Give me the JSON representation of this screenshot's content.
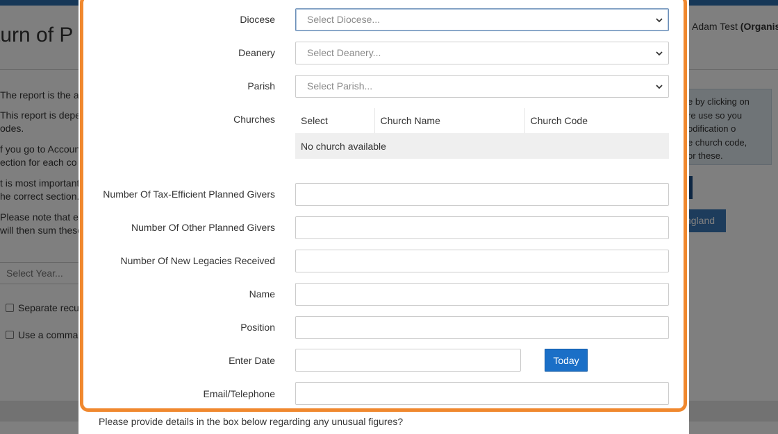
{
  "background": {
    "title": "turn of P",
    "user": {
      "name": "Adam Test",
      "org": "(Organisa"
    },
    "paragraphs": [
      "The report is the an",
      "This report is deper",
      "odes.",
      "f you go to Accoun",
      "ection for each co",
      "t is most important",
      "he correct section.",
      "Please note that ea",
      "will then sum these"
    ],
    "right_panel": [
      "e by clicking on",
      "re use so you",
      "odification o",
      "e church code,",
      "or these."
    ],
    "england_button": "ngland",
    "select_year": "Select Year...",
    "checkboxes": [
      "Separate recu",
      "Use a comma"
    ]
  },
  "form": {
    "diocese": {
      "label": "Diocese",
      "placeholder": "Select Diocese..."
    },
    "deanery": {
      "label": "Deanery",
      "placeholder": "Select Deanery..."
    },
    "parish": {
      "label": "Parish",
      "placeholder": "Select Parish..."
    },
    "churches": {
      "label": "Churches",
      "columns": [
        "Select",
        "Church Name",
        "Church Code"
      ],
      "empty_message": "No church available"
    },
    "tax_givers": {
      "label": "Number Of Tax-Efficient Planned Givers",
      "value": ""
    },
    "other_givers": {
      "label": "Number Of Other Planned Givers",
      "value": ""
    },
    "legacies": {
      "label": "Number Of New Legacies Received",
      "value": ""
    },
    "name": {
      "label": "Name",
      "value": ""
    },
    "position": {
      "label": "Position",
      "value": ""
    },
    "enter_date": {
      "label": "Enter Date",
      "value": "",
      "today_button": "Today"
    },
    "email_phone": {
      "label": "Email/Telephone",
      "value": ""
    },
    "unusual_prompt": "Please provide details in the box below regarding any unusual figures?"
  },
  "colors": {
    "highlight": "#f0882e",
    "primary_button": "#1a6fc7"
  },
  "icons": {
    "select_arrow": "chevron-down-icon"
  }
}
